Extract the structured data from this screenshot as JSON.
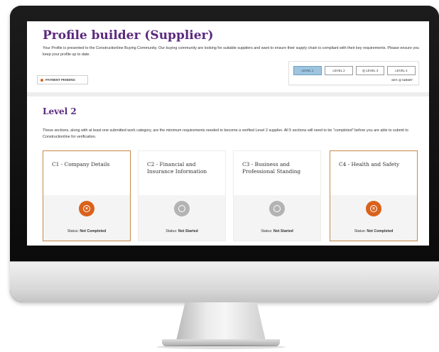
{
  "header": {
    "title": "Profile builder (Supplier)",
    "intro": "Your Profile is presented to the Constructionline Buying Community. Our buying community are looking for suitable suppliers and want to ensure their supply chain is compliant with their key requirements. Please ensure you keep your profile up to date.",
    "payment_badge": "PAYMENT PENDING"
  },
  "levels": {
    "buttons": [
      {
        "label": "LEVEL 1",
        "active": true,
        "icon": ""
      },
      {
        "label": "LEVEL 2",
        "active": false,
        "icon": ""
      },
      {
        "label": "LEVEL 3",
        "active": false,
        "icon": "target-icon"
      },
      {
        "label": "LEVEL 4",
        "active": false,
        "icon": ""
      }
    ],
    "key_label": "KEY:",
    "key_target_label": "TARGET"
  },
  "section": {
    "heading": "Level 2",
    "description": "These sections, along with at least one submitted work category, are the minimum requirements needed to become a verified Level 2 supplier. All 5 sections will need to be \"completed\" before you are able to submit to Constructionline for verification."
  },
  "cards": [
    {
      "title": "C1 - Company Details",
      "status_prefix": "Status:",
      "status": "Not Completed",
      "icon": "close-circle-icon"
    },
    {
      "title": "C2 - Financial and Insurance Information",
      "status_prefix": "Status:",
      "status": "Not Started",
      "icon": "empty-circle-icon"
    },
    {
      "title": "C3 - Business and Professional Standing",
      "status_prefix": "Status:",
      "status": "Not Started",
      "icon": "empty-circle-icon"
    },
    {
      "title": "C4 - Health and Safety",
      "status_prefix": "Status:",
      "status": "Not Completed",
      "icon": "close-circle-icon"
    }
  ],
  "colors": {
    "brand_purple": "#5b2a7e",
    "status_orange": "#d9621c",
    "status_grey": "#b3b3b3",
    "active_level": "#9ec5e0"
  }
}
